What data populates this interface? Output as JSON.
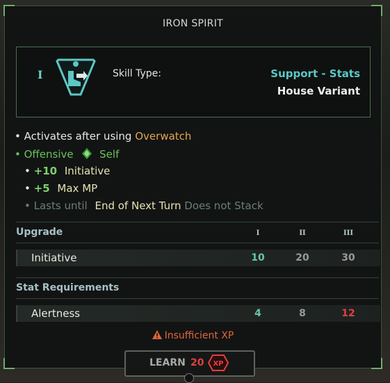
{
  "title": "IRON SPIRIT",
  "header": {
    "tier": "I",
    "skill_type_label": "Skill Type:",
    "skill_type_value": "Support - Stats",
    "variant": "House Variant",
    "icon": "boot-arrow-icon"
  },
  "effects": {
    "activates_prefix": "Activates after using",
    "activates_ability": "Overwatch",
    "offensive": "Offensive",
    "target": "Self",
    "bonuses": [
      {
        "amount": "+10",
        "stat": "Initiative"
      },
      {
        "amount": "+5",
        "stat": "Max MP"
      }
    ],
    "duration_prefix": "Lasts until",
    "duration_value": "End of Next Turn",
    "stack_note": "Does not Stack"
  },
  "upgrade": {
    "title": "Upgrade",
    "tiers": [
      "I",
      "II",
      "III"
    ],
    "row_label": "Initiative",
    "values": [
      "10",
      "20",
      "30"
    ]
  },
  "requirements": {
    "title": "Stat Requirements",
    "row_label": "Alertness",
    "values": [
      "4",
      "8",
      "12"
    ]
  },
  "warning": "Insufficient XP",
  "learn": {
    "label": "LEARN",
    "cost": "20",
    "currency": "XP"
  },
  "colors": {
    "accent_teal": "#5cc7c4",
    "ability_orange": "#e4a44e",
    "offensive_green": "#6ac15a",
    "insufficient_red": "#e04040"
  }
}
